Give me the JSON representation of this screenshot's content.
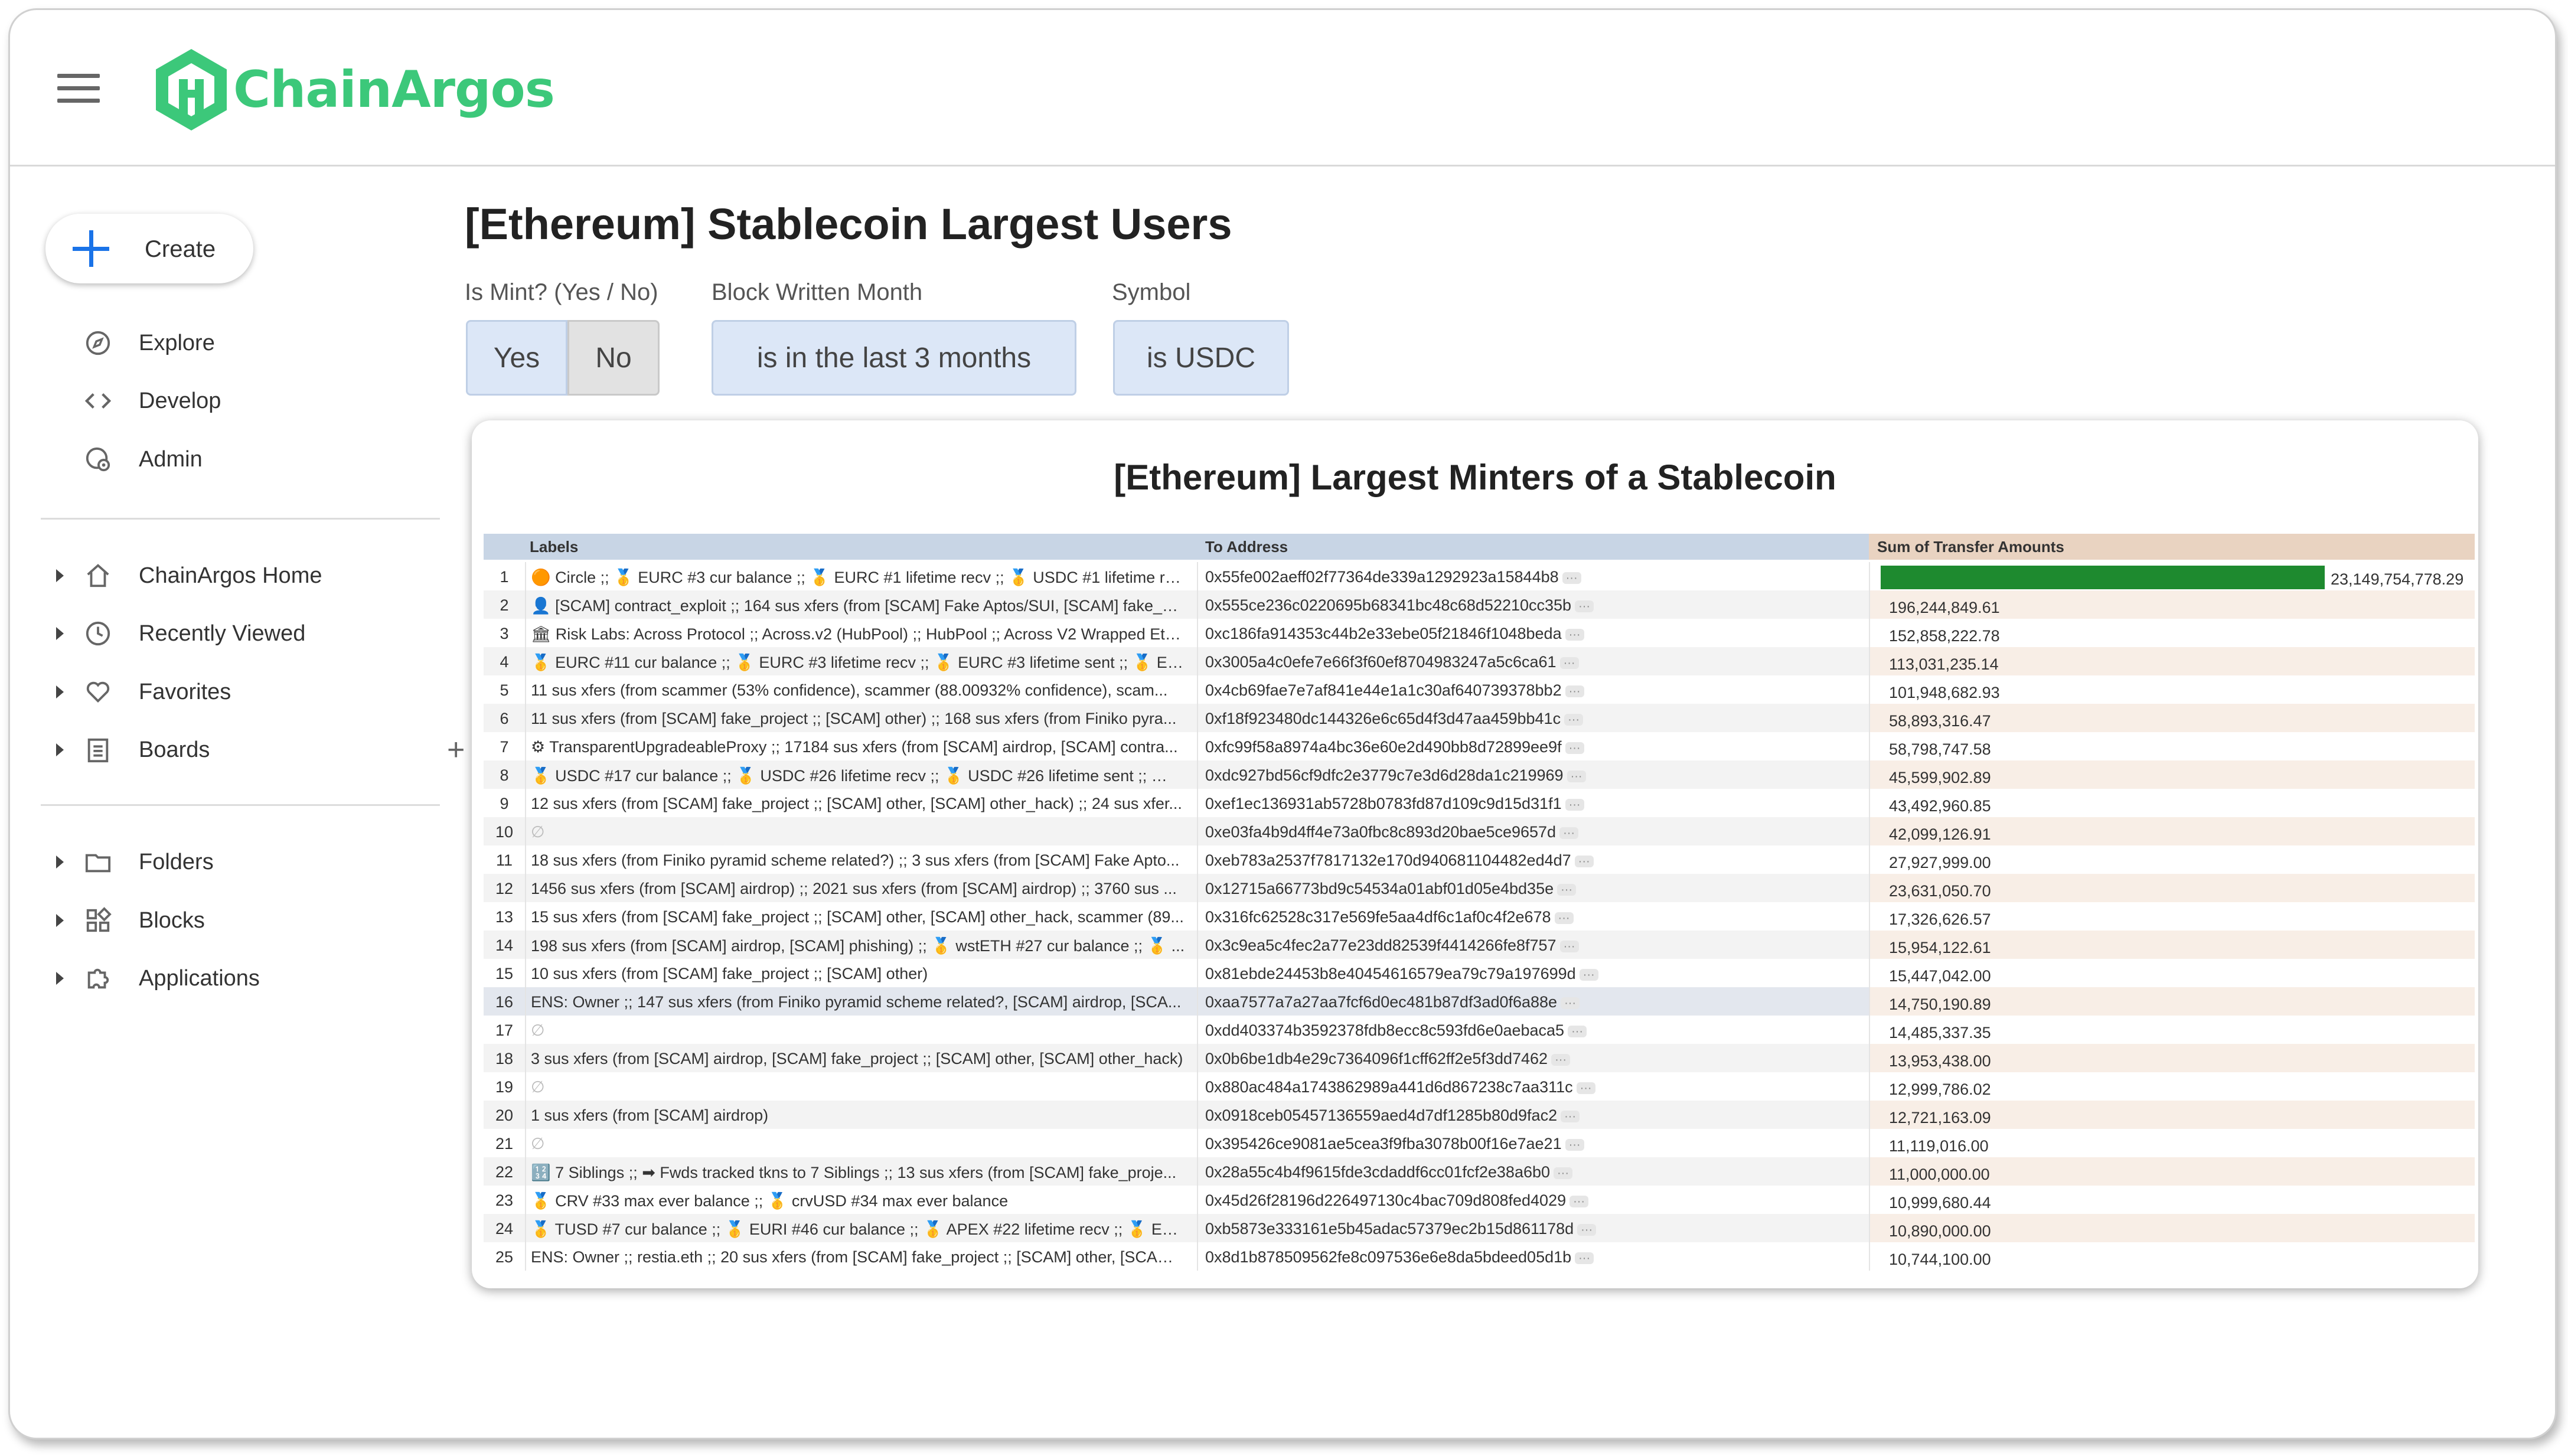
{
  "app": {
    "logo_text": "ChainArgos",
    "brand_color": "#3cc87a"
  },
  "sidebar": {
    "create_label": "Create",
    "primary": [
      {
        "label": "Explore",
        "icon": "compass-icon"
      },
      {
        "label": "Develop",
        "icon": "code-icon"
      },
      {
        "label": "Admin",
        "icon": "admin-icon"
      }
    ],
    "sections": [
      {
        "label": "ChainArgos Home",
        "icon": "home-icon"
      },
      {
        "label": "Recently Viewed",
        "icon": "clock-icon"
      },
      {
        "label": "Favorites",
        "icon": "heart-icon"
      },
      {
        "label": "Boards",
        "icon": "board-icon"
      }
    ],
    "sections2": [
      {
        "label": "Folders",
        "icon": "folder-icon"
      },
      {
        "label": "Blocks",
        "icon": "blocks-icon"
      },
      {
        "label": "Applications",
        "icon": "puzzle-icon"
      }
    ]
  },
  "page": {
    "title": "[Ethereum] Stablecoin Largest Users"
  },
  "filters": {
    "is_mint_label": "Is Mint? (Yes / No)",
    "is_mint_options": [
      "Yes",
      "No"
    ],
    "is_mint_selected": "Yes",
    "block_month_label": "Block Written Month",
    "block_month_value": "is in the last 3 months",
    "symbol_label": "Symbol",
    "symbol_value": "is USDC"
  },
  "tile": {
    "title": "[Ethereum] Largest Minters of a Stablecoin",
    "columns": [
      "Labels",
      "To Address",
      "Sum of Transfer Amounts"
    ],
    "bar_color": "#1e8a2f",
    "rows": [
      {
        "n": "1",
        "labels": "🟠 Circle ;; 🥇 EURC #3 cur balance ;; 🥇 EURC #1 lifetime recv ;; 🥇 USDC #1 lifetime recv...",
        "address": "0x55fe002aeff02f77364de339a1292923a15844b8",
        "amount": "23,149,754,778.29",
        "value": 23149754778.29
      },
      {
        "n": "2",
        "labels": "👤 [SCAM] contract_exploit ;; 164 sus xfers (from [SCAM] Fake Aptos/SUI, [SCAM] fake_pr...",
        "address": "0x555ce236c0220695b68341bc48c68d52210cc35b",
        "amount": "196,244,849.61",
        "value": 196244849.61
      },
      {
        "n": "3",
        "labels": "🏛 Risk Labs: Across Protocol ;; Across.v2 (HubPool) ;; HubPool ;; Across V2 Wrapped Eth...",
        "address": "0xc186fa914353c44b2e33ebe05f21846f1048beda",
        "amount": "152,858,222.78",
        "value": 152858222.78
      },
      {
        "n": "4",
        "labels": "🥇 EURC #11 cur balance ;; 🥇 EURC #3 lifetime recv ;; 🥇 EURC #3 lifetime sent ;; 🥇 EUR...",
        "address": "0x3005a4c0efe7e66f3f60ef8704983247a5c6ca61",
        "amount": "113,031,235.14",
        "value": 113031235.14
      },
      {
        "n": "5",
        "labels": "11 sus xfers (from scammer (53% confidence), scammer (88.00932% confidence), scam...",
        "address": "0x4cb69fae7e7af841e44e1a1c30af640739378bb2",
        "amount": "101,948,682.93",
        "value": 101948682.93
      },
      {
        "n": "6",
        "labels": "11 sus xfers (from [SCAM] fake_project ;; [SCAM] other) ;; 168 sus xfers (from Finiko pyra...",
        "address": "0xf18f923480dc144326e6c65d4f3d47aa459bb41c",
        "amount": "58,893,316.47",
        "value": 58893316.47
      },
      {
        "n": "7",
        "labels": "⚙ TransparentUpgradeableProxy ;; 17184 sus xfers (from [SCAM] airdrop, [SCAM] contra...",
        "address": "0xfc99f58a8974a4bc36e60e2d490bb8d72899ee9f",
        "amount": "58,798,747.58",
        "value": 58798747.58
      },
      {
        "n": "8",
        "labels": "🥇 USDC #17 cur balance ;; 🥇 USDC #26 lifetime recv ;; 🥇 USDC #26 lifetime sent ;; 🥇 U...",
        "address": "0xdc927bd56cf9dfc2e3779c7e3d6d28da1c219969",
        "amount": "45,599,902.89",
        "value": 45599902.89
      },
      {
        "n": "9",
        "labels": "12 sus xfers (from [SCAM] fake_project ;; [SCAM] other, [SCAM] other_hack) ;; 24 sus xfer...",
        "address": "0xef1ec136931ab5728b0783fd87d109c9d15d31f1",
        "amount": "43,492,960.85",
        "value": 43492960.85
      },
      {
        "n": "10",
        "labels": "∅",
        "address": "0xe03fa4b9d4ff4e73a0fbc8c893d20bae5ce9657d",
        "amount": "42,099,126.91",
        "value": 42099126.91
      },
      {
        "n": "11",
        "labels": "18 sus xfers (from Finiko pyramid scheme related?) ;; 3 sus xfers (from [SCAM] Fake Apto...",
        "address": "0xeb783a2537f7817132e170d940681104482ed4d7",
        "amount": "27,927,999.00",
        "value": 27927999.0
      },
      {
        "n": "12",
        "labels": "1456 sus xfers (from [SCAM] airdrop) ;; 2021 sus xfers (from [SCAM] airdrop) ;; 3760 sus ...",
        "address": "0x12715a66773bd9c54534a01abf01d05e4bd35e",
        "amount": "23,631,050.70",
        "value": 23631050.7
      },
      {
        "n": "13",
        "labels": "15 sus xfers (from [SCAM] fake_project ;; [SCAM] other, [SCAM] other_hack, scammer (89...",
        "address": "0x316fc62528c317e569fe5aa4df6c1af0c4f2e678",
        "amount": "17,326,626.57",
        "value": 17326626.57
      },
      {
        "n": "14",
        "labels": "198 sus xfers (from [SCAM] airdrop, [SCAM] phishing) ;; 🥇 wstETH #27 cur balance ;; 🥇 ...",
        "address": "0x3c9ea5c4fec2a77e23dd82539f4414266fe8f757",
        "amount": "15,954,122.61",
        "value": 15954122.61
      },
      {
        "n": "15",
        "labels": "10 sus xfers (from [SCAM] fake_project ;; [SCAM] other)",
        "address": "0x81ebde24453b8e40454616579ea79c79a197699d",
        "amount": "15,447,042.00",
        "value": 15447042.0
      },
      {
        "n": "16",
        "labels": "ENS: Owner ;; 147 sus xfers (from Finiko pyramid scheme related?, [SCAM] airdrop, [SCA...",
        "address": "0xaa7577a7a27aa7fcf6d0ec481b87df3ad0f6a88e",
        "amount": "14,750,190.89",
        "value": 14750190.89
      },
      {
        "n": "17",
        "labels": "∅",
        "address": "0xdd403374b3592378fdb8ecc8c593fd6e0aebaca5",
        "amount": "14,485,337.35",
        "value": 14485337.35
      },
      {
        "n": "18",
        "labels": "3 sus xfers (from [SCAM] airdrop, [SCAM] fake_project ;; [SCAM] other, [SCAM] other_hack)",
        "address": "0x0b6be1db4e29c7364096f1cff62ff2e5f3dd7462",
        "amount": "13,953,438.00",
        "value": 13953438.0
      },
      {
        "n": "19",
        "labels": "∅",
        "address": "0x880ac484a1743862989a441d6d867238c7aa311c",
        "amount": "12,999,786.02",
        "value": 12999786.02
      },
      {
        "n": "20",
        "labels": "1 sus xfers (from [SCAM] airdrop)",
        "address": "0x0918ceb05457136559aed4d7df1285b80d9fac2",
        "amount": "12,721,163.09",
        "value": 12721163.09
      },
      {
        "n": "21",
        "labels": "∅",
        "address": "0x395426ce9081ae5cea3f9fba3078b00f16e7ae21",
        "amount": "11,119,016.00",
        "value": 11119016.0
      },
      {
        "n": "22",
        "labels": "🔢 7 Siblings ;; ➡ Fwds tracked tkns to 7 Siblings ;; 13 sus xfers (from [SCAM] fake_proje...",
        "address": "0x28a55c4b4f9615fde3cdaddf6cc01fcf2e38a6b0",
        "amount": "11,000,000.00",
        "value": 11000000.0
      },
      {
        "n": "23",
        "labels": "🥇 CRV #33 max ever balance ;; 🥇 crvUSD #34 max ever balance",
        "address": "0x45d26f28196d226497130c4bac709d808fed4029",
        "amount": "10,999,680.44",
        "value": 10999680.44
      },
      {
        "n": "24",
        "labels": "🥇 TUSD #7 cur balance ;; 🥇 EURI #46 cur balance ;; 🥇 APEX #22 lifetime recv ;; 🥇 EURI ...",
        "address": "0xb5873e333161e5b45adac57379ec2b15d861178d",
        "amount": "10,890,000.00",
        "value": 10890000.0
      },
      {
        "n": "25",
        "labels": "ENS: Owner ;; restia.eth ;; 20 sus xfers (from [SCAM] fake_project ;; [SCAM] other, [SCAM] ...",
        "address": "0x8d1b878509562fe8c097536e6e8da5bdeed05d1b",
        "amount": "10,744,100.00",
        "value": 10744100.0
      }
    ]
  }
}
